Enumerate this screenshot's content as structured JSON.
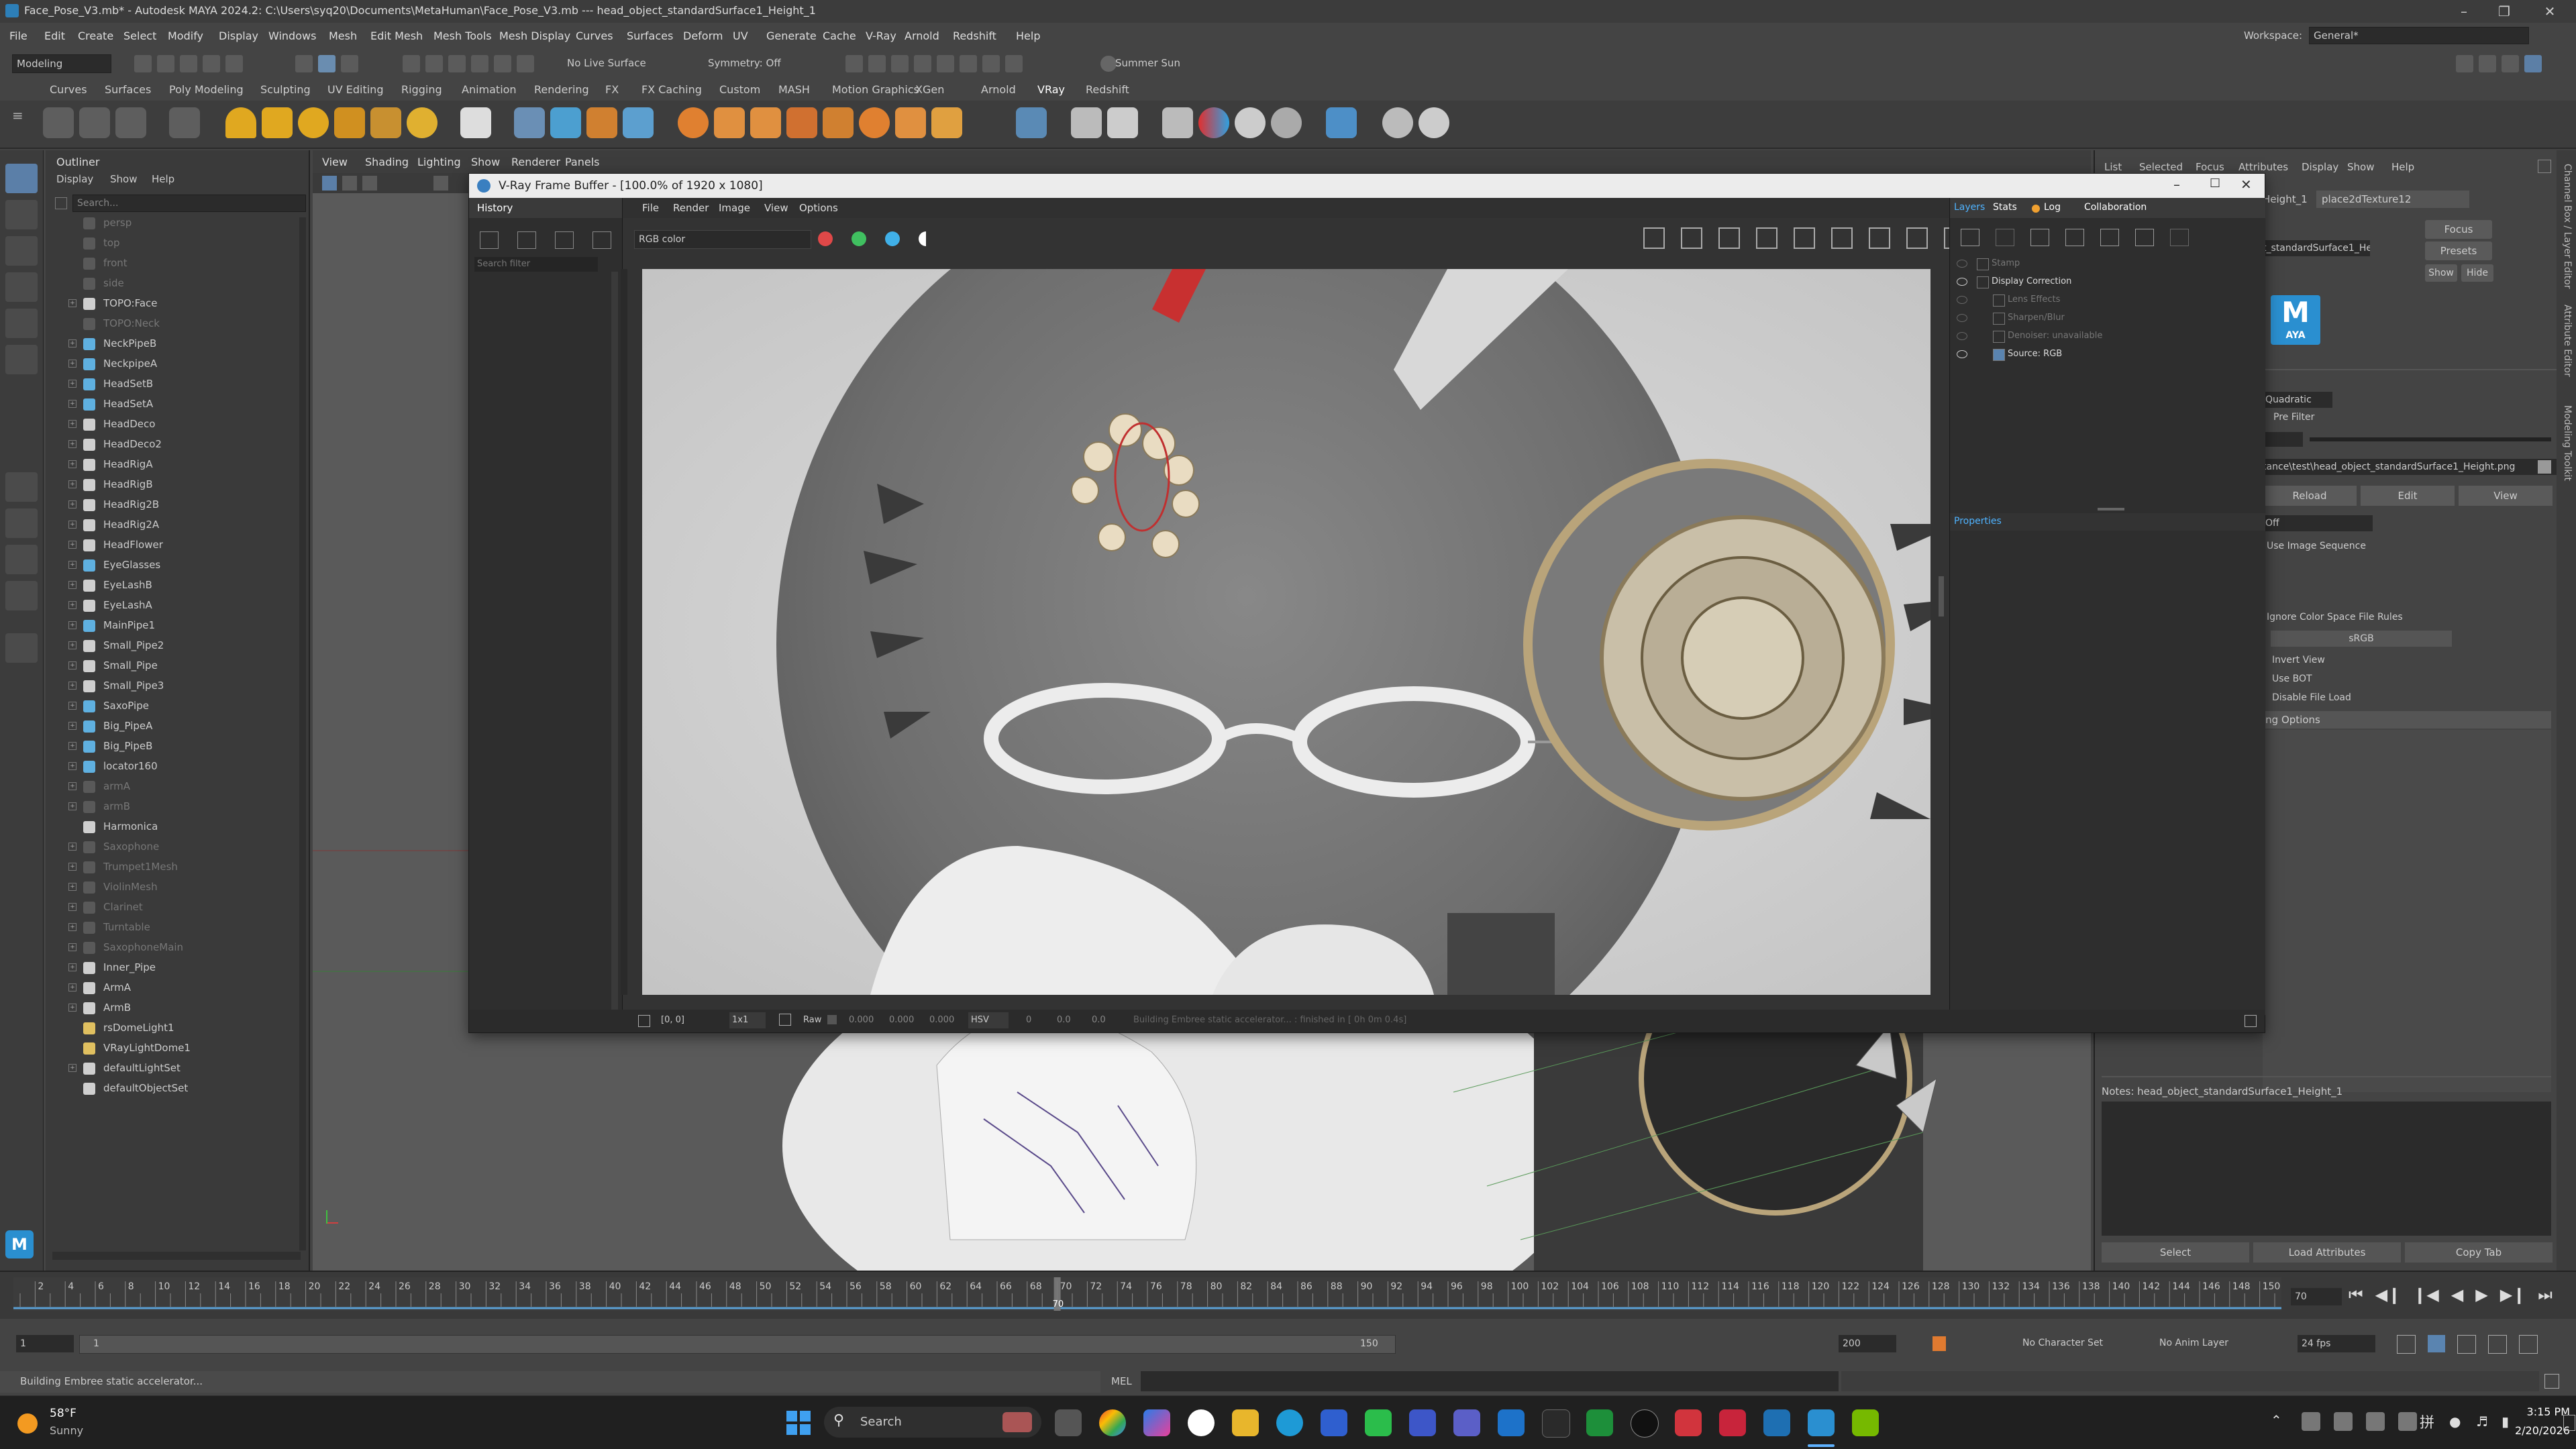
{
  "window": {
    "title": "Face_Pose_V3.mb* - Autodesk MAYA 2024.2: C:\\Users\\syq20\\Documents\\MetaHuman\\Face_Pose_V3.mb   ---   head_object_standardSurface1_Height_1"
  },
  "menubar": [
    "File",
    "Edit",
    "Create",
    "Select",
    "Modify",
    "Display",
    "Windows",
    "Mesh",
    "Edit Mesh",
    "Mesh Tools",
    "Mesh Display",
    "Curves",
    "Surfaces",
    "Deform",
    "UV",
    "Generate",
    "Cache",
    "V-Ray",
    "Arnold",
    "Redshift",
    "Help"
  ],
  "workspace": {
    "label": "Workspace:",
    "value": "General*"
  },
  "statusline": {
    "mode": "Modeling",
    "live_surface": "No Live Surface",
    "symmetry": "Symmetry: Off",
    "light": "Summer Sun"
  },
  "shelf_tabs": [
    "Curves",
    "Surfaces",
    "Poly Modeling",
    "Sculpting",
    "UV Editing",
    "Rigging",
    "Animation",
    "Rendering",
    "FX",
    "FX Caching",
    "Custom",
    "MASH",
    "Motion Graphics",
    "XGen",
    "Arnold",
    "VRay",
    "Redshift"
  ],
  "shelf_active": "VRay",
  "outliner": {
    "title": "Outliner",
    "menu": [
      "Display",
      "Show",
      "Help"
    ],
    "search_placeholder": "Search...",
    "items": [
      {
        "name": "persp",
        "dim": true,
        "exp": false,
        "color": "#777"
      },
      {
        "name": "top",
        "dim": true,
        "exp": false,
        "color": "#777"
      },
      {
        "name": "front",
        "dim": true,
        "exp": false,
        "color": "#777"
      },
      {
        "name": "side",
        "dim": true,
        "exp": false,
        "color": "#777"
      },
      {
        "name": "TOPO:Face",
        "dim": false,
        "exp": true,
        "color": "#cfcfcf"
      },
      {
        "name": "TOPO:Neck",
        "dim": true,
        "exp": false,
        "color": "#777"
      },
      {
        "name": "NeckPipeB",
        "dim": false,
        "exp": true,
        "color": "#5fb0e0"
      },
      {
        "name": "NeckpipeA",
        "dim": false,
        "exp": true,
        "color": "#5fb0e0"
      },
      {
        "name": "HeadSetB",
        "dim": false,
        "exp": true,
        "color": "#5fb0e0"
      },
      {
        "name": "HeadSetA",
        "dim": false,
        "exp": true,
        "color": "#5fb0e0"
      },
      {
        "name": "HeadDeco",
        "dim": false,
        "exp": true,
        "color": "#cfcfcf"
      },
      {
        "name": "HeadDeco2",
        "dim": false,
        "exp": true,
        "color": "#cfcfcf"
      },
      {
        "name": "HeadRigA",
        "dim": false,
        "exp": true,
        "color": "#cfcfcf"
      },
      {
        "name": "HeadRigB",
        "dim": false,
        "exp": true,
        "color": "#cfcfcf"
      },
      {
        "name": "HeadRig2B",
        "dim": false,
        "exp": true,
        "color": "#cfcfcf"
      },
      {
        "name": "HeadRig2A",
        "dim": false,
        "exp": true,
        "color": "#cfcfcf"
      },
      {
        "name": "HeadFlower",
        "dim": false,
        "exp": true,
        "color": "#cfcfcf"
      },
      {
        "name": "EyeGlasses",
        "dim": false,
        "exp": true,
        "color": "#5fb0e0"
      },
      {
        "name": "EyeLashB",
        "dim": false,
        "exp": true,
        "color": "#cfcfcf"
      },
      {
        "name": "EyeLashA",
        "dim": false,
        "exp": true,
        "color": "#cfcfcf"
      },
      {
        "name": "MainPipe1",
        "dim": false,
        "exp": true,
        "color": "#5fb0e0"
      },
      {
        "name": "Small_Pipe2",
        "dim": false,
        "exp": true,
        "color": "#cfcfcf"
      },
      {
        "name": "Small_Pipe",
        "dim": false,
        "exp": true,
        "color": "#cfcfcf"
      },
      {
        "name": "Small_Pipe3",
        "dim": false,
        "exp": true,
        "color": "#cfcfcf"
      },
      {
        "name": "SaxoPipe",
        "dim": false,
        "exp": true,
        "color": "#5fb0e0"
      },
      {
        "name": "Big_PipeA",
        "dim": false,
        "exp": true,
        "color": "#5fb0e0"
      },
      {
        "name": "Big_PipeB",
        "dim": false,
        "exp": true,
        "color": "#5fb0e0"
      },
      {
        "name": "locator160",
        "dim": false,
        "exp": true,
        "color": "#5fb0e0"
      },
      {
        "name": "armA",
        "dim": true,
        "exp": true,
        "color": "#777"
      },
      {
        "name": "armB",
        "dim": true,
        "exp": true,
        "color": "#777"
      },
      {
        "name": "Harmonica",
        "dim": false,
        "exp": false,
        "color": "#cfcfcf"
      },
      {
        "name": "Saxophone",
        "dim": true,
        "exp": true,
        "color": "#777"
      },
      {
        "name": "Trumpet1Mesh",
        "dim": true,
        "exp": true,
        "color": "#777"
      },
      {
        "name": "ViolinMesh",
        "dim": true,
        "exp": true,
        "color": "#777"
      },
      {
        "name": "Clarinet",
        "dim": true,
        "exp": true,
        "color": "#777"
      },
      {
        "name": "Turntable",
        "dim": true,
        "exp": true,
        "color": "#777"
      },
      {
        "name": "SaxophoneMain",
        "dim": true,
        "exp": true,
        "color": "#777"
      },
      {
        "name": "Inner_Pipe",
        "dim": false,
        "exp": true,
        "color": "#cfcfcf"
      },
      {
        "name": "ArmA",
        "dim": false,
        "exp": true,
        "color": "#cfcfcf"
      },
      {
        "name": "ArmB",
        "dim": false,
        "exp": true,
        "color": "#cfcfcf"
      },
      {
        "name": "rsDomeLight1",
        "dim": false,
        "exp": false,
        "color": "#e0c060"
      },
      {
        "name": "VRayLightDome1",
        "dim": false,
        "exp": false,
        "color": "#e0c060"
      },
      {
        "name": "defaultLightSet",
        "dim": false,
        "exp": true,
        "color": "#cfcfcf"
      },
      {
        "name": "defaultObjectSet",
        "dim": false,
        "exp": false,
        "color": "#cfcfcf"
      }
    ]
  },
  "viewport_menu": [
    "View",
    "Shading",
    "Lighting",
    "Show",
    "Renderer",
    "Panels"
  ],
  "vfb": {
    "title": "V-Ray Frame Buffer - [100.0% of 1920 x 1080]",
    "menu": [
      "File",
      "Render",
      "Image",
      "View",
      "Options"
    ],
    "history": {
      "label": "History",
      "filter": "Search filter"
    },
    "channel": "RGB color",
    "right_tabs": [
      "Layers",
      "Stats",
      "Log",
      "Collaboration"
    ],
    "layers": [
      {
        "name": "Stamp",
        "dim": true
      },
      {
        "name": "Display Correction",
        "dim": false
      },
      {
        "name": "Lens Effects",
        "dim": true
      },
      {
        "name": "Sharpen/Blur",
        "dim": true
      },
      {
        "name": "Denoiser: unavailable",
        "dim": true
      },
      {
        "name": "Source: RGB",
        "dim": false
      }
    ],
    "properties": "Properties",
    "bottom": {
      "coords": "[0, 0]",
      "zoom": "1x1",
      "raw": "Raw",
      "r": "0.000",
      "g": "0.000",
      "b": "0.000",
      "mode": "HSV",
      "h": "0",
      "s": "0.0",
      "v": "0.0",
      "status": "Building Embree static accelerator... : finished in [ 0h  0m  0.4s]"
    }
  },
  "attr": {
    "tabs": [
      "List",
      "Selected",
      "Focus",
      "Attributes",
      "Display",
      "Show",
      "Help"
    ],
    "node_tab1": "Height_1",
    "node_tab2": "place2dTexture12",
    "node_field": "t_standardSurface1_Height_1",
    "focus": "Focus",
    "presets": "Presets",
    "show": "Show",
    "hide": "Hide",
    "filter_type": "Quadratic",
    "pre_filter": "Pre Filter",
    "file_path": "tance\\test\\head_object_standardSurface1_Height.png",
    "reload": "Reload",
    "edit": "Edit",
    "view": "View",
    "uv_tiling": "Off",
    "use_image_seq": "Use Image Sequence",
    "ignore_cs": "Ignore Color Space File Rules",
    "color_space": "sRGB",
    "invert_view": "Invert View",
    "use_bot": "Use BOT",
    "disable_load": "Disable File Load",
    "section": "ing Options",
    "notes": "Notes:  head_object_standardSurface1_Height_1",
    "btn_select": "Select",
    "btn_load": "Load Attributes",
    "btn_copy": "Copy Tab"
  },
  "right_strip": [
    "Channel Box / Layer Editor",
    "Attribute Editor",
    "Modeling Toolkit"
  ],
  "timeline": {
    "ticks": [
      2,
      4,
      6,
      8,
      10,
      12,
      14,
      16,
      18,
      20,
      22,
      24,
      26,
      28,
      30,
      32,
      34,
      36,
      38,
      40,
      42,
      44,
      46,
      48,
      50,
      52,
      54,
      56,
      58,
      60,
      62,
      64,
      66,
      68,
      70,
      72,
      74,
      76,
      78,
      80,
      82,
      84,
      86,
      88,
      90,
      92,
      94,
      96,
      98,
      100,
      102,
      104,
      106,
      108,
      110,
      112,
      114,
      116,
      118,
      120,
      122,
      124,
      126,
      128,
      130,
      132,
      134,
      136,
      138,
      140,
      142,
      144,
      146,
      148,
      150
    ],
    "current": "70",
    "current_field": "70"
  },
  "range": {
    "start": "1",
    "start_inner": "1",
    "end_inner": "150",
    "end": "200",
    "char_set": "No Character Set",
    "anim_layer": "No Anim Layer",
    "fps": "24 fps"
  },
  "cmd": {
    "help": "Building Embree static accelerator...",
    "mel": "MEL"
  },
  "taskbar": {
    "weather_temp": "58°F",
    "weather_desc": "Sunny",
    "search": "Search",
    "time": "3:15 PM",
    "date": "2/20/2026",
    "lang": "拼"
  }
}
